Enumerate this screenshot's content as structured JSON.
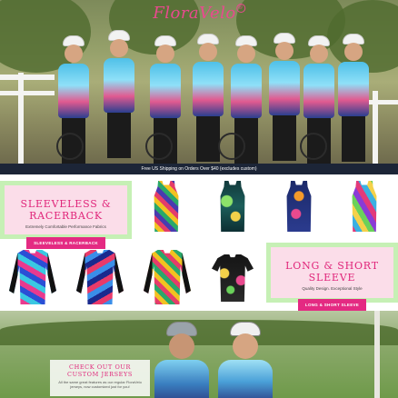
{
  "brand": {
    "logo_text": "FloraVelo",
    "logo_mark": "®"
  },
  "shipping_bar": {
    "text": "Free US Shipping on Orders Over $40 (excludes custom)"
  },
  "sleeveless_section": {
    "title": "SLEEVELESS & RACERBACK",
    "subtitle": "Extremely Comfortable Performance Fabrics",
    "button_label": "SLEEVELESS & RACERBACK"
  },
  "sleeve_section": {
    "title": "LONG & SHORT SLEEVE",
    "subtitle": "Quality Design. Exceptional Style",
    "button_label": "LONG & SHORT SLEEVE"
  },
  "custom_section": {
    "title_line1": "CHECK OUT OUR",
    "title_line2": "CUSTOM JERSEYS",
    "text_line1": "All the same great features as our regular FloraVelo",
    "text_line2": "jerseys, now customized just for you!"
  },
  "colors": {
    "brand_pink": "#e42a82",
    "promo_green": "#c6f0b5",
    "promo_pink": "#fbdde9",
    "shipping_bar_bg": "#1c2537"
  },
  "products_row1": [
    "sleeveless-jersey-1",
    "sleeveless-jersey-2",
    "sleeveless-jersey-3",
    "sleeveless-jersey-4"
  ],
  "products_row2": [
    "long-sleeve-jersey-1",
    "long-sleeve-jersey-2",
    "long-sleeve-jersey-3",
    "short-sleeve-jersey-1"
  ]
}
